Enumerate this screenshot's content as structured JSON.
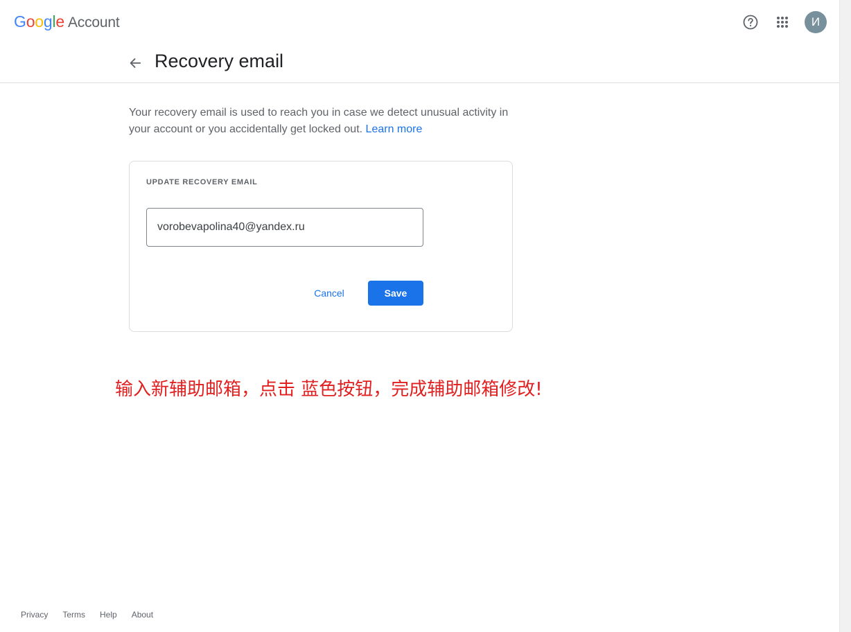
{
  "header": {
    "logo_letters": [
      {
        "ch": "G",
        "color": "#4285F4"
      },
      {
        "ch": "o",
        "color": "#EA4335"
      },
      {
        "ch": "o",
        "color": "#FBBC05"
      },
      {
        "ch": "g",
        "color": "#4285F4"
      },
      {
        "ch": "l",
        "color": "#34A853"
      },
      {
        "ch": "e",
        "color": "#EA4335"
      }
    ],
    "logo_suffix": "Account",
    "help_icon": "help-circle-icon",
    "apps_icon": "apps-grid-icon",
    "avatar_initial": "И",
    "avatar_color": "#78909c"
  },
  "subheader": {
    "back_icon": "arrow-back-icon",
    "title": "Recovery email"
  },
  "description": {
    "text": "Your recovery email is used to reach you in case we detect unusual activity in your account or you accidentally get locked out.",
    "link": "Learn more"
  },
  "card": {
    "title": "UPDATE RECOVERY EMAIL",
    "email_value": "vorobevapolina40@yandex.ru",
    "cancel_label": "Cancel",
    "save_label": "Save",
    "accent": "#1a73e8"
  },
  "annotation": "输入新辅助邮箱，点击 蓝色按钮，完成辅助邮箱修改!",
  "footer": {
    "links": [
      "Privacy",
      "Terms",
      "Help",
      "About"
    ]
  }
}
